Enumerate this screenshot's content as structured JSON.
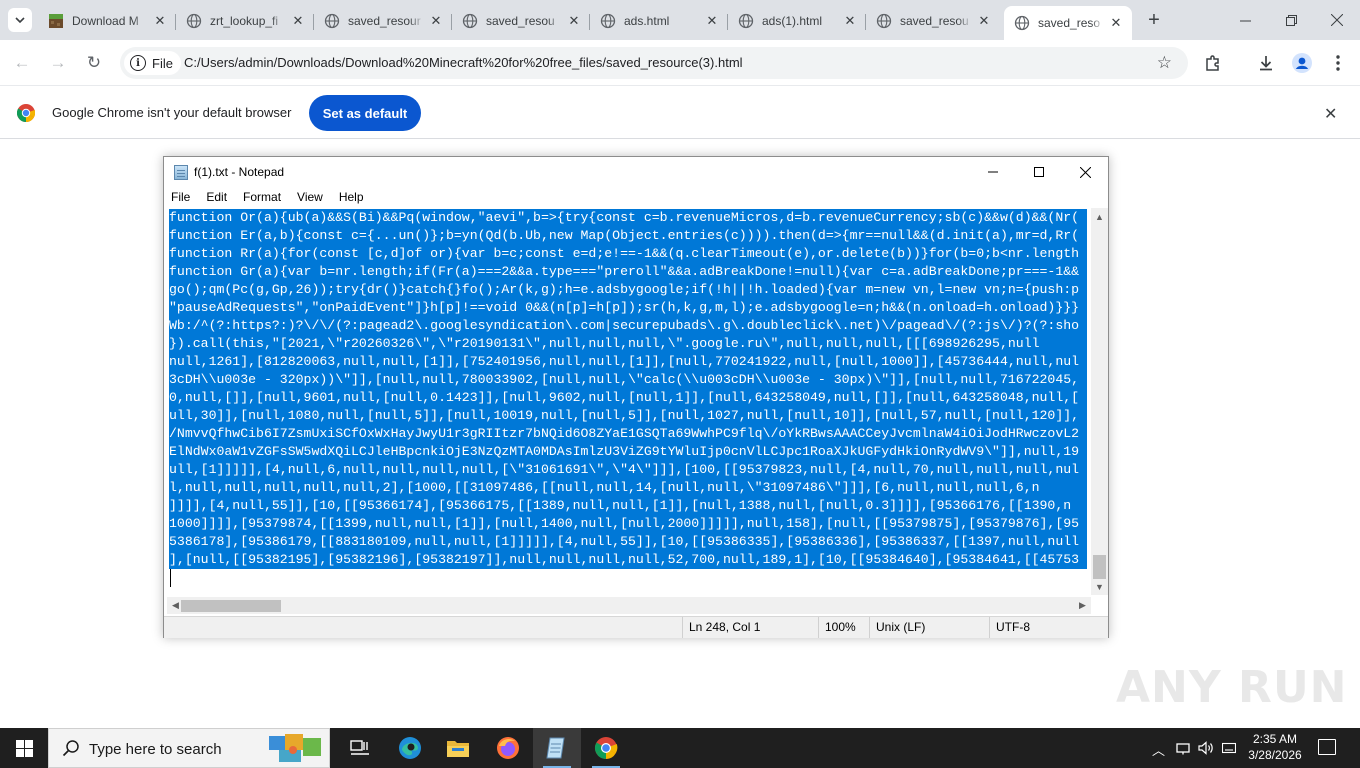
{
  "browser": {
    "tabs": [
      {
        "title": "Download M",
        "icon": "minecraft-icon",
        "active": false
      },
      {
        "title": "zrt_lookup_fi",
        "icon": "globe-icon",
        "active": false
      },
      {
        "title": "saved_resour",
        "icon": "globe-icon",
        "active": false
      },
      {
        "title": "saved_resou",
        "icon": "globe-icon",
        "active": false
      },
      {
        "title": "ads.html",
        "icon": "globe-icon",
        "active": false
      },
      {
        "title": "ads(1).html",
        "icon": "globe-icon",
        "active": false
      },
      {
        "title": "saved_resou",
        "icon": "globe-icon",
        "active": false
      },
      {
        "title": "saved_reso",
        "icon": "globe-icon",
        "active": true
      }
    ],
    "omnibox": {
      "chip_label": "File",
      "url": "C:/Users/admin/Downloads/Download%20Minecraft%20for%20free_files/saved_resource(3).html"
    },
    "infobar": {
      "message": "Google Chrome isn't your default browser",
      "button_label": "Set as default"
    }
  },
  "notepad": {
    "title": "f(1).txt - Notepad",
    "menu": [
      "File",
      "Edit",
      "Format",
      "View",
      "Help"
    ],
    "lines": [
      "function Or(a){ub(a)&&S(Bi)&&Pq(window,\"aevi\",b=>{try{const c=b.revenueMicros,d=b.revenueCurrency;sb(c)&&w(d)&&(Nr(",
      "function Er(a,b){const c={...un()};b=yn(Qd(b.Ub,new Map(Object.entries(c)))).then(d=>{mr==null&&(d.init(a),mr=d,Rr(",
      "function Rr(a){for(const [c,d]of or){var b=c;const e=d;e!==-1&&(q.clearTimeout(e),or.delete(b))}for(b=0;b<nr.length",
      "function Gr(a){var b=nr.length;if(Fr(a)===2&&a.type===\"preroll\"&&a.adBreakDone!=null){var c=a.adBreakDone;pr===-1&&",
      "go();qm(Pc(g,Gp,26));try{dr()}catch{}fo();Ar(k,g);h=e.adsbygoogle;if(!h||!h.loaded){var m=new vn,l=new vn;n={push:p",
      "\"pauseAdRequests\",\"onPaidEvent\"]}h[p]!==void 0&&(n[p]=h[p]);sr(h,k,g,m,l);e.adsbygoogle=n;h&&(n.onload=h.onload)}}}",
      "Wb:/^(?:https?:)?\\/\\/(?:pagead2\\.googlesyndication\\.com|securepubads\\.g\\.doubleclick\\.net)\\/pagead\\/(?:js\\/)?(?:sho",
      "}).call(this,\"[2021,\\\"r20260326\\\",\\\"r20190131\\\",null,null,null,\\\".google.ru\\\",null,null,null,[[[698926295,null",
      "null,1261],[812820063,null,null,[1]],[752401956,null,null,[1]],[null,770241922,null,[null,1000]],[45736444,null,nul",
      "3cDH\\\\u003e - 320px))\\\"]],[null,null,780033902,[null,null,\\\"calc(\\\\u003cDH\\\\u003e - 30px)\\\"]],[null,null,716722045,",
      "0,null,[]],[null,9601,null,[null,0.1423]],[null,9602,null,[null,1]],[null,643258049,null,[]],[null,643258048,null,[",
      "ull,30]],[null,1080,null,[null,5]],[null,10019,null,[null,5]],[null,1027,null,[null,10]],[null,57,null,[null,120]],",
      "/NmvvQfhwCib6I7ZsmUxiSCfOxWxHayJwyU1r3gRIItzr7bNQid6O8ZYaE1GSQTa69WwhPC9flq\\/oYkRBwsAAACCeyJvcmlnaW4iOiJodHRwczovL2",
      "ElNdWx0aW1vZGFsSW5wdXQiLCJleHBpcnkiOjE3NzQzMTA0MDAsImlzU3ViZG9tYWluIjp0cnVlLCJpc1RoaXJkUGFydHkiOnRydWV9\\\"]],null,19",
      "ull,[1]]]]],[4,null,6,null,null,null,null,[\\\"31061691\\\",\\\"4\\\"]]],[100,[[95379823,null,[4,null,70,null,null,null,nul",
      "l,null,null,null,null,null,2],[1000,[[31097486,[[null,null,14,[null,null,\\\"31097486\\\"]]],[6,null,null,null,6,n",
      "]]]],[4,null,55]],[10,[[95366174],[95366175,[[1389,null,null,[1]],[null,1388,null,[null,0.3]]]],[95366176,[[1390,n",
      "1000]]]],[95379874,[[1399,null,null,[1]],[null,1400,null,[null,2000]]]]],null,158],[null,[[95379875],[95379876],[95",
      "5386178],[95386179,[[883180109,null,null,[1]]]]],[4,null,55]],[10,[[95386335],[95386336],[95386337,[[1397,null,null",
      "],[null,[[95382195],[95382196],[95382197]],null,null,null,null,52,700,null,189,1],[10,[[95384640],[95384641,[[45753"
    ],
    "status": {
      "position": "Ln 248, Col 1",
      "zoom": "100%",
      "line_ending": "Unix (LF)",
      "encoding": "UTF-8"
    }
  },
  "watermark": "ANY RUN",
  "taskbar": {
    "search_placeholder": "Type here to search",
    "apps": [
      "widgets-icon",
      "task-view-icon",
      "edge-icon",
      "file-explorer-icon",
      "firefox-icon",
      "notepad-icon",
      "chrome-icon"
    ],
    "time": "2:35 AM",
    "date": "3/28/2026"
  },
  "colors": {
    "selection": "#0078d7",
    "chrome_accent": "#0b57d0",
    "taskbar": "#1f1f1f"
  }
}
